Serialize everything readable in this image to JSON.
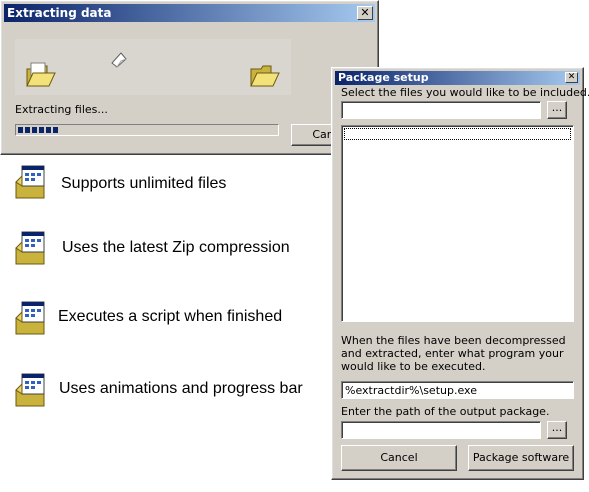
{
  "extract_window": {
    "title": "Extracting data",
    "close_label": "✕",
    "status_text": "Extracting files...",
    "progress_percent": 16,
    "cancel_label": "Cancel"
  },
  "features": [
    {
      "text": "Supports unlimited files",
      "icon": "installer-window-icon"
    },
    {
      "text": "Uses the latest Zip compression",
      "icon": "installer-window-icon"
    },
    {
      "text": "Executes a script when finished",
      "icon": "installer-window-icon"
    },
    {
      "text": "Uses animations and progress bar",
      "icon": "installer-window-icon"
    }
  ],
  "package_setup": {
    "title": "Package setup",
    "close_label": "✕",
    "select_files_label": "Select the files you would like to be included.",
    "select_files_value": "",
    "browse_label": "...",
    "file_list": [],
    "program_label": "When the files have been decompressed and extracted, enter what program your would like to be executed.",
    "program_value": "%extractdir%\\setup.exe",
    "output_label": "Enter the path of the output package.",
    "output_value": "",
    "output_browse_label": "...",
    "cancel_label": "Cancel",
    "package_label": "Package software"
  },
  "colors": {
    "title_start": "#0a246a",
    "title_end": "#a6caf0",
    "face": "#d4d0c8",
    "progress": "#0a246a"
  }
}
